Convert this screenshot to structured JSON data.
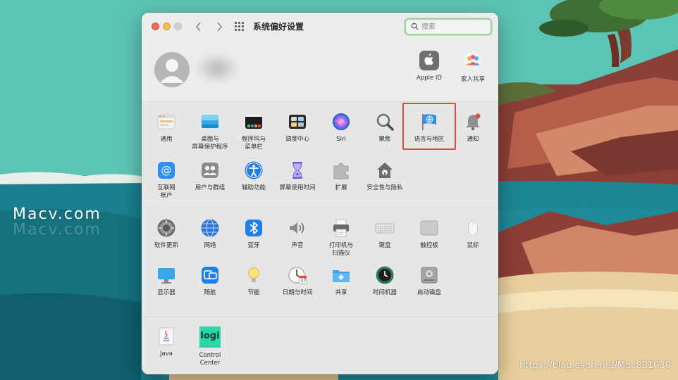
{
  "desktop": {
    "watermark_text": "Macv.com",
    "watermark_echo": "Macv.com",
    "source_url": "https://blog.csdn.net/Mac881030"
  },
  "window": {
    "title": "系统偏好设置",
    "search_placeholder": "搜索"
  },
  "account": {
    "items": [
      {
        "label": "Apple ID",
        "icon": "apple-id-icon"
      },
      {
        "label": "家人共享",
        "icon": "family-sharing-icon"
      }
    ]
  },
  "panes_row1": [
    {
      "label": "通用",
      "icon": "general-icon"
    },
    {
      "label": "桌面与\n屏幕保护程序",
      "icon": "desktop-screensaver-icon"
    },
    {
      "label": "程序坞与\n菜单栏",
      "icon": "dock-menubar-icon"
    },
    {
      "label": "调度中心",
      "icon": "mission-control-icon"
    },
    {
      "label": "Siri",
      "icon": "siri-icon"
    },
    {
      "label": "聚焦",
      "icon": "spotlight-icon"
    },
    {
      "label": "语言与地区",
      "icon": "language-region-icon"
    },
    {
      "label": "通知",
      "icon": "notifications-icon"
    }
  ],
  "panes_row2": [
    {
      "label": "互联网\n帐户",
      "icon": "internet-accounts-icon"
    },
    {
      "label": "用户与群组",
      "icon": "users-groups-icon"
    },
    {
      "label": "辅助功能",
      "icon": "accessibility-icon"
    },
    {
      "label": "屏幕使用时间",
      "icon": "screen-time-icon"
    },
    {
      "label": "扩展",
      "icon": "extensions-icon"
    },
    {
      "label": "安全性与隐私",
      "icon": "security-privacy-icon"
    }
  ],
  "panes_row3": [
    {
      "label": "软件更新",
      "icon": "software-update-icon"
    },
    {
      "label": "网络",
      "icon": "network-icon"
    },
    {
      "label": "蓝牙",
      "icon": "bluetooth-icon"
    },
    {
      "label": "声音",
      "icon": "sound-icon"
    },
    {
      "label": "打印机与\n扫描仪",
      "icon": "printers-scanners-icon"
    },
    {
      "label": "键盘",
      "icon": "keyboard-icon"
    },
    {
      "label": "触控板",
      "icon": "trackpad-icon"
    },
    {
      "label": "鼠标",
      "icon": "mouse-icon"
    }
  ],
  "panes_row4": [
    {
      "label": "显示器",
      "icon": "displays-icon"
    },
    {
      "label": "随航",
      "icon": "sidecar-icon"
    },
    {
      "label": "节能",
      "icon": "energy-saver-icon"
    },
    {
      "label": "日期与时间",
      "icon": "date-time-icon"
    },
    {
      "label": "共享",
      "icon": "sharing-icon"
    },
    {
      "label": "时间机器",
      "icon": "time-machine-icon"
    },
    {
      "label": "启动磁盘",
      "icon": "startup-disk-icon"
    }
  ],
  "panes_row5": [
    {
      "label": "Java",
      "icon": "java-icon"
    },
    {
      "label": "Control Center",
      "icon": "logi-control-center-icon"
    }
  ],
  "logi_text": "logi",
  "date_icon_day": "17",
  "highlight_color": "#e0473d"
}
